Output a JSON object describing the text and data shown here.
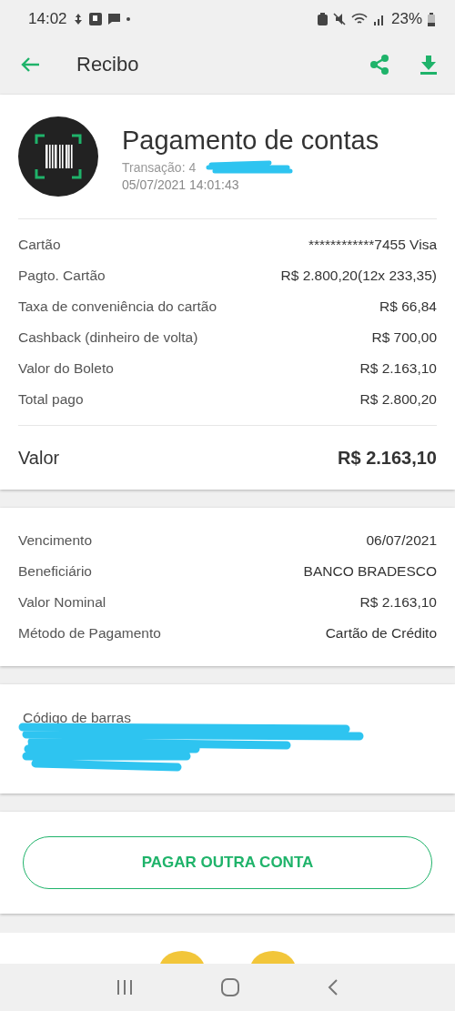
{
  "status_bar": {
    "time": "14:02",
    "battery": "23%"
  },
  "app_bar": {
    "title": "Recibo"
  },
  "header": {
    "title": "Pagamento de contas",
    "transaction": "Transação: 4",
    "datetime": "05/07/2021 14:01:43"
  },
  "payment_rows": [
    {
      "label": "Cartão",
      "value": "************7455 Visa"
    },
    {
      "label": "Pagto. Cartão",
      "value": "R$ 2.800,20(12x 233,35)"
    },
    {
      "label": "Taxa de conveniência do cartão",
      "value": "R$ 66,84"
    },
    {
      "label": "Cashback (dinheiro de volta)",
      "value": "R$ 700,00"
    },
    {
      "label": "Valor do Boleto",
      "value": "R$ 2.163,10"
    },
    {
      "label": "Total pago",
      "value": "R$ 2.800,20"
    }
  ],
  "total": {
    "label": "Valor",
    "value": "R$ 2.163,10"
  },
  "detail_rows": [
    {
      "label": "Vencimento",
      "value": "06/07/2021"
    },
    {
      "label": "Beneficiário",
      "value": "BANCO BRADESCO"
    },
    {
      "label": "Valor Nominal",
      "value": "R$ 2.163,10"
    },
    {
      "label": "Método de Pagamento",
      "value": "Cartão de Crédito"
    }
  ],
  "barcode": {
    "label": "Código de barras"
  },
  "button": {
    "label": "PAGAR OUTRA CONTA"
  }
}
